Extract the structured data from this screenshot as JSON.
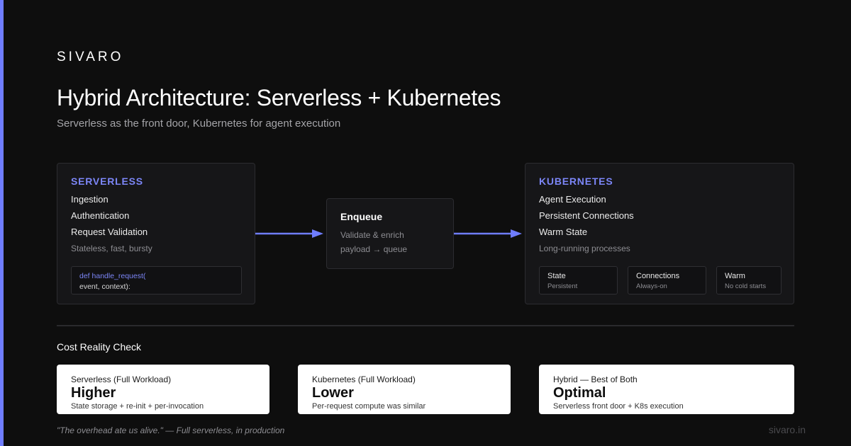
{
  "brand": "SIVARO",
  "title": "Hybrid Architecture: Serverless + Kubernetes",
  "subtitle": "Serverless as the front door, Kubernetes for agent execution",
  "serverless": {
    "heading": "SERVERLESS",
    "items": [
      "Ingestion",
      "Authentication",
      "Request Validation"
    ],
    "note": "Stateless, fast, bursty",
    "code": [
      "def handle_request(",
      "event, context):"
    ]
  },
  "enqueue": {
    "title": "Enqueue",
    "lines": [
      "Validate & enrich",
      "payload → queue"
    ]
  },
  "kubernetes": {
    "heading": "KUBERNETES",
    "items": [
      "Agent Execution",
      "Persistent Connections",
      "Warm State"
    ],
    "note": "Long-running processes",
    "cards": [
      {
        "title": "State",
        "sub": "Persistent"
      },
      {
        "title": "Connections",
        "sub": "Always-on"
      },
      {
        "title": "Warm",
        "sub": "No cold starts"
      }
    ]
  },
  "cost": {
    "section_title": "Cost Reality Check",
    "cards": [
      {
        "label": "Serverless (Full Workload)",
        "value": "Higher",
        "desc": "State storage + re-init + per-invocation"
      },
      {
        "label": "Kubernetes (Full Workload)",
        "value": "Lower",
        "desc": "Per-request compute was similar"
      },
      {
        "label": "Hybrid — Best of Both",
        "value": "Optimal",
        "desc": "Serverless front door + K8s execution"
      }
    ]
  },
  "footer": {
    "quote": "\"The overhead ate us alive.\" — Full serverless, in production",
    "site": "sivaro.in"
  },
  "colors": {
    "accent": "#6f7dff",
    "heading_accent": "#7c86f7",
    "background": "#0e0e0e",
    "panel": "#161618"
  }
}
